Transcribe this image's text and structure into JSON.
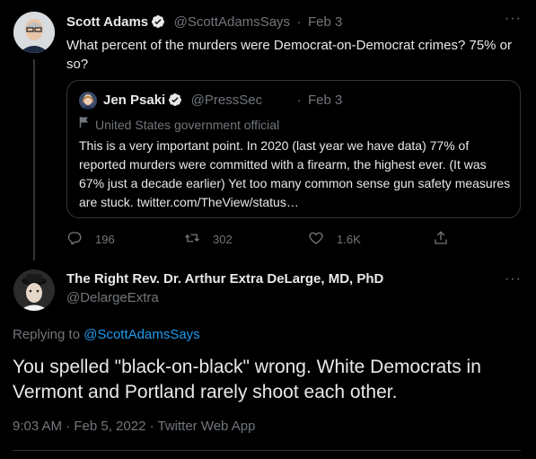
{
  "tweet": {
    "author_name": "Scott Adams",
    "author_handle": "@ScottAdamsSays",
    "separator": "·",
    "date": "Feb 3",
    "text": "What percent of the murders were Democrat-on-Democrat crimes? 75% or so?",
    "more_icon": "more-horizontal-icon",
    "quote": {
      "author_name": "Jen Psaki",
      "author_handle": "@PressSec",
      "separator": "·",
      "date": "Feb 3",
      "label": "United States government official",
      "label_icon": "flag-icon",
      "text": "This is a very important point. In 2020 (last year we have data) 77% of reported murders were committed with a firearm, the highest ever. (It was 67% just a decade earlier)   Yet too many common sense gun safety measures are stuck. twitter.com/TheView/status…"
    },
    "actions": {
      "reply_count": "196",
      "retweet_count": "302",
      "like_count": "1.6K"
    }
  },
  "reply": {
    "author_name": "The Right Rev. Dr. Arthur Extra DeLarge, MD, PhD",
    "author_handle": "@DelargeExtra",
    "replying_to_prefix": "Replying to",
    "replying_to_handle": "@ScottAdamsSays",
    "text": "You spelled \"black-on-black\" wrong. White Democrats in Vermont and Portland rarely shoot each other.",
    "timestamp": "9:03 AM · Feb 5, 2022 · Twitter Web App"
  },
  "colors": {
    "background": "#000000",
    "text": "#e7e9ea",
    "muted": "#71767b",
    "accent": "#1d9bf0",
    "border": "#333639"
  }
}
